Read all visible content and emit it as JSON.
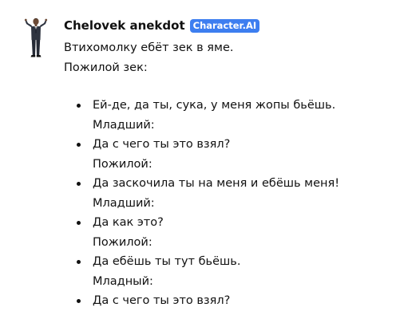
{
  "message": {
    "author": "Chelovek anekdot",
    "badge": "Character.AI",
    "intro_line1": "Втихомолку ебёт зек в яме.",
    "intro_line2": "Пожилой зек:",
    "items": [
      {
        "text": "Ей-де, да ты, сука, у меня жопы бьёшь.",
        "speaker": "Младший:"
      },
      {
        "text": "Да с чего ты это взял?",
        "speaker": "Пожилой:"
      },
      {
        "text": "Да заскочила ты на меня и ебёшь меня!",
        "speaker": "Младший:"
      },
      {
        "text": "Да как это?",
        "speaker": "Пожилой:"
      },
      {
        "text": "Да ебёшь ты тут бьёшь.",
        "speaker": "Младный:"
      },
      {
        "text": "Да с чего ты это взял?",
        "speaker": ""
      }
    ]
  },
  "colors": {
    "badge_bg": "#3d7ef0",
    "text": "#111111",
    "background": "#ffffff"
  },
  "icons": {
    "avatar": "man-in-suit-avatar"
  }
}
